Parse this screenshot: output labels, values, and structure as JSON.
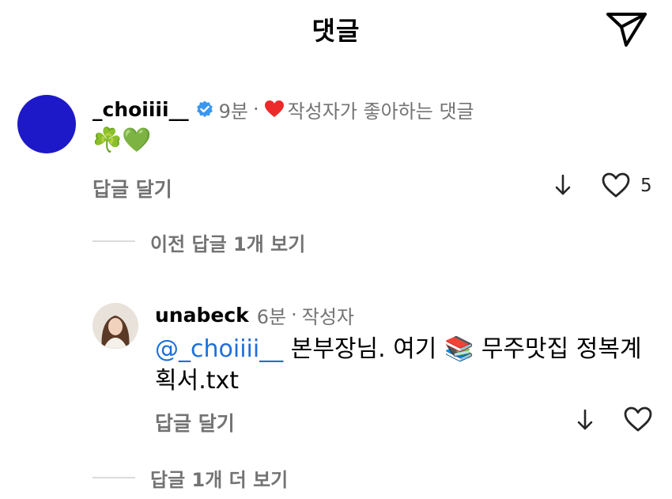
{
  "header": {
    "title": "댓글",
    "send_icon": "paper-plane-icon"
  },
  "comment1": {
    "username": "_choiiii__",
    "verified": true,
    "time": "9분",
    "separator": "·",
    "liked_by_author_text": "작성자가 좋아하는 댓글",
    "body": "☘️💚",
    "reply_label": "답글 달기",
    "like_count": "5",
    "avatar_color": "#1e19c8"
  },
  "view_previous": {
    "label": "이전 답글 1개 보기"
  },
  "comment2": {
    "username": "unabeck",
    "time": "6분",
    "separator": "·",
    "author_badge": "작성자",
    "mention": "@_choiiii__",
    "body_text": " 본부장님. 여기 📚 무주맛집 정복계획서.txt",
    "reply_label": "답글 달기"
  },
  "view_more": {
    "label": "답글 1개 더 보기"
  },
  "colors": {
    "secondary_text": "#737373",
    "mention": "#1e6fd9",
    "verified": "#3897f0",
    "like_heart": "#ed2a2a"
  }
}
